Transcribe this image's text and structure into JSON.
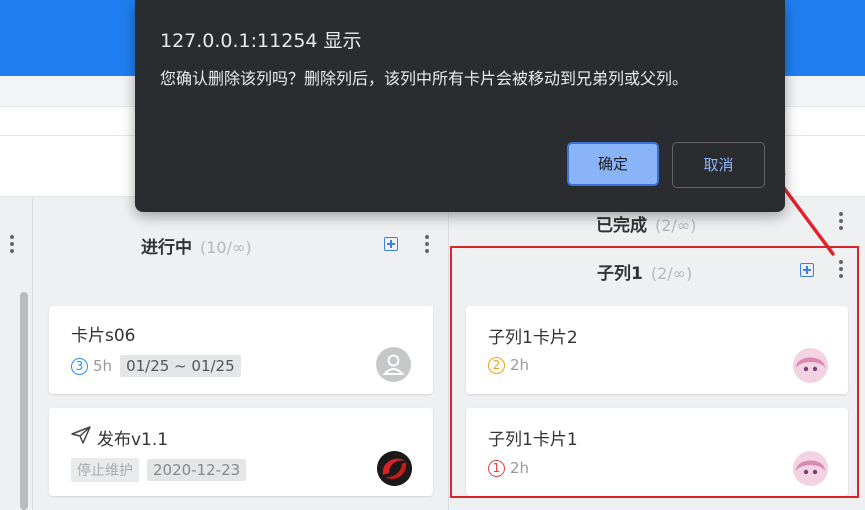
{
  "dialog": {
    "title": "127.0.0.1:11254 显示",
    "message": "您确认删除该列吗？删除列后，该列中所有卡片会被移动到兄弟列或父列。",
    "ok_label": "确定",
    "cancel_label": "取消"
  },
  "columns": {
    "in_progress": {
      "title": "进行中",
      "count": "(10/∞)"
    },
    "done": {
      "title": "已完成",
      "count": "(2/∞)"
    },
    "sub1": {
      "title": "子列1",
      "count": "(2/∞)"
    }
  },
  "cards": [
    {
      "title": "卡片s06",
      "priority": "3",
      "estimate": "5h",
      "date_range": "01/25 ~ 01/25",
      "avatar": "default-user-icon"
    },
    {
      "title": "发布v1.1",
      "icon": "send-icon",
      "status_tag": "停止维护",
      "date": "2020-12-23",
      "avatar": "brand-logo"
    },
    {
      "title": "子列1卡片2",
      "priority": "2",
      "estimate": "2h",
      "avatar": "anime-avatar"
    },
    {
      "title": "子列1卡片1",
      "priority": "1",
      "estimate": "2h",
      "avatar": "anime-avatar"
    }
  ],
  "colors": {
    "top_bar": "#1f7ff0",
    "dialog_bg": "#2b2c30",
    "primary_button": "#8ab4f8",
    "highlight": "#d8242d",
    "priority_1": "#e04444",
    "priority_2": "#f0a020",
    "priority_3": "#2d8cf0"
  }
}
